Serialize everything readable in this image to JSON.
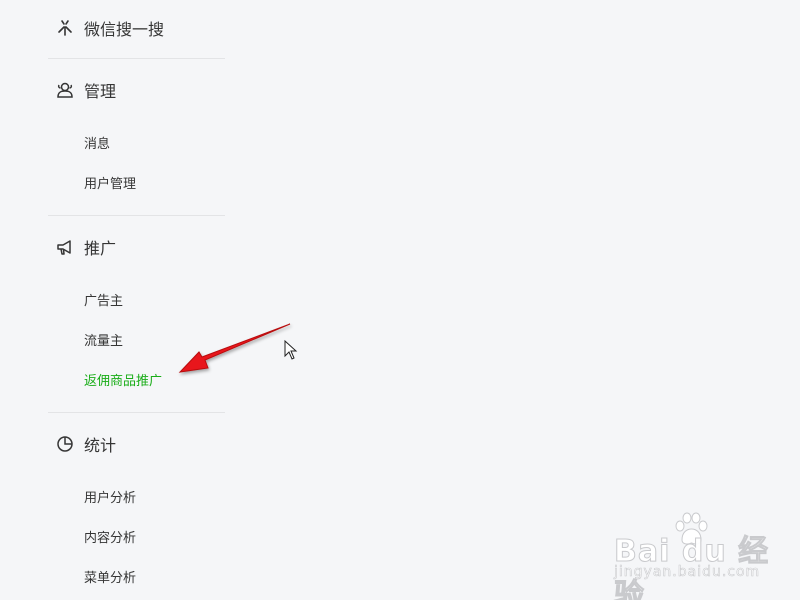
{
  "sidebar": {
    "top": {
      "label": "微信搜一搜",
      "icon": "sparkle-icon"
    },
    "sections": [
      {
        "title": "管理",
        "icon": "users-icon",
        "items": [
          "消息",
          "用户管理"
        ]
      },
      {
        "title": "推广",
        "icon": "megaphone-icon",
        "items": [
          "广告主",
          "流量主",
          "返佣商品推广"
        ],
        "active_item": "返佣商品推广"
      },
      {
        "title": "统计",
        "icon": "pie-chart-icon",
        "items": [
          "用户分析",
          "内容分析",
          "菜单分析"
        ]
      }
    ]
  },
  "colors": {
    "background": "#f5f6f8",
    "text": "#353535",
    "active": "#1aad19",
    "divider": "#e3e4e6",
    "arrow": "#e8141b"
  },
  "watermark": {
    "logo": "Bai du 经验",
    "url": "jingyan.baidu.com"
  }
}
